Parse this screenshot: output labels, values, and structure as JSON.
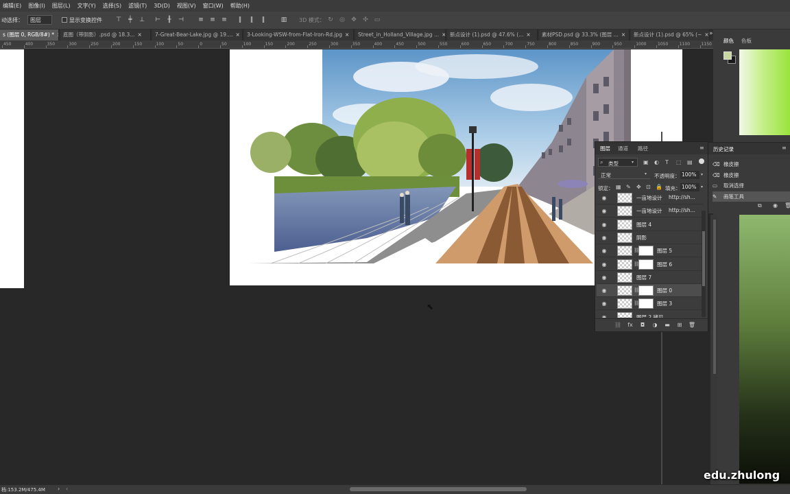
{
  "menu": [
    "编辑(E)",
    "图像(I)",
    "图层(L)",
    "文字(Y)",
    "选择(S)",
    "滤镜(T)",
    "3D(D)",
    "视图(V)",
    "窗口(W)",
    "帮助(H)"
  ],
  "options": {
    "auto_select_label": "动选择：",
    "auto_select_value": "图层",
    "show_transform_label": "显示变换控件",
    "mode_3d_label": "3D 模式："
  },
  "tabs": [
    {
      "label": "s (图层 0, RGB/8#) *",
      "active": true
    },
    {
      "label": "底图（带阴影）.psd @ 18.3...",
      "active": false
    },
    {
      "label": "7-Great-Bear-Lake.jpg @ 19....",
      "active": false
    },
    {
      "label": "3-Looking-WSW-from-Flat-Iron-Rd.jpg",
      "active": false
    },
    {
      "label": "Street_in_Holland_Village.jpg ...",
      "active": false
    },
    {
      "label": "新点设计 (1).psd @ 47.6% (...",
      "active": false
    },
    {
      "label": "素材PSD.psd @ 33.3% (图层 ...",
      "active": false
    },
    {
      "label": "新点设计 (1).psd @ 65% (~",
      "active": false
    }
  ],
  "ruler_ticks": [
    "450",
    "400",
    "350",
    "300",
    "250",
    "200",
    "150",
    "100",
    "50",
    "0",
    "50",
    "100",
    "150",
    "200",
    "250",
    "300",
    "350",
    "400",
    "450",
    "500",
    "550",
    "600",
    "650",
    "700",
    "750",
    "800",
    "850",
    "900",
    "950",
    "1000",
    "1050",
    "1100",
    "1150"
  ],
  "color_panel": {
    "tabs": [
      "颜色",
      "色板"
    ],
    "foreground": "#c8d8a0",
    "background": "#1a1a1a"
  },
  "history_panel": {
    "title": "历史记录",
    "items": [
      {
        "label": "橡皮擦",
        "icon": "eraser-icon",
        "selected": false
      },
      {
        "label": "橡皮擦",
        "icon": "eraser-icon",
        "selected": false
      },
      {
        "label": "取消选择",
        "icon": "deselect-icon",
        "selected": false
      },
      {
        "label": "画笔工具",
        "icon": "brush-icon",
        "selected": true
      }
    ]
  },
  "layers_panel": {
    "tabs": [
      "图层",
      "通道",
      "路径"
    ],
    "filter_label": "类型",
    "blend_mode": "正常",
    "opacity_label": "不透明度：",
    "opacity_value": "100%",
    "lock_label": "锁定：",
    "fill_label": "填充：",
    "fill_value": "100%",
    "layers": [
      {
        "name": "一亩地设计",
        "url": "http://sh...",
        "visible": true,
        "mask": false,
        "selected": false
      },
      {
        "name": "一亩地设计",
        "url": "http://sh...",
        "visible": true,
        "mask": false,
        "selected": false
      },
      {
        "name": "图层 4",
        "url": "",
        "visible": true,
        "mask": false,
        "selected": false
      },
      {
        "name": "阴影",
        "url": "",
        "visible": true,
        "mask": false,
        "selected": false
      },
      {
        "name": "图层 5",
        "url": "",
        "visible": true,
        "mask": true,
        "selected": false
      },
      {
        "name": "图层 6",
        "url": "",
        "visible": true,
        "mask": true,
        "selected": false
      },
      {
        "name": "图层 7",
        "url": "",
        "visible": true,
        "mask": false,
        "selected": false
      },
      {
        "name": "图层 0",
        "url": "",
        "visible": true,
        "mask": true,
        "selected": true
      },
      {
        "name": "图层 3",
        "url": "",
        "visible": true,
        "mask": true,
        "selected": false
      },
      {
        "name": "图层 2 拷贝",
        "url": "",
        "visible": true,
        "mask": false,
        "selected": false
      }
    ]
  },
  "status": {
    "doc_size": "档:153.2M/475.4M"
  },
  "watermark": "edu.zhulong"
}
